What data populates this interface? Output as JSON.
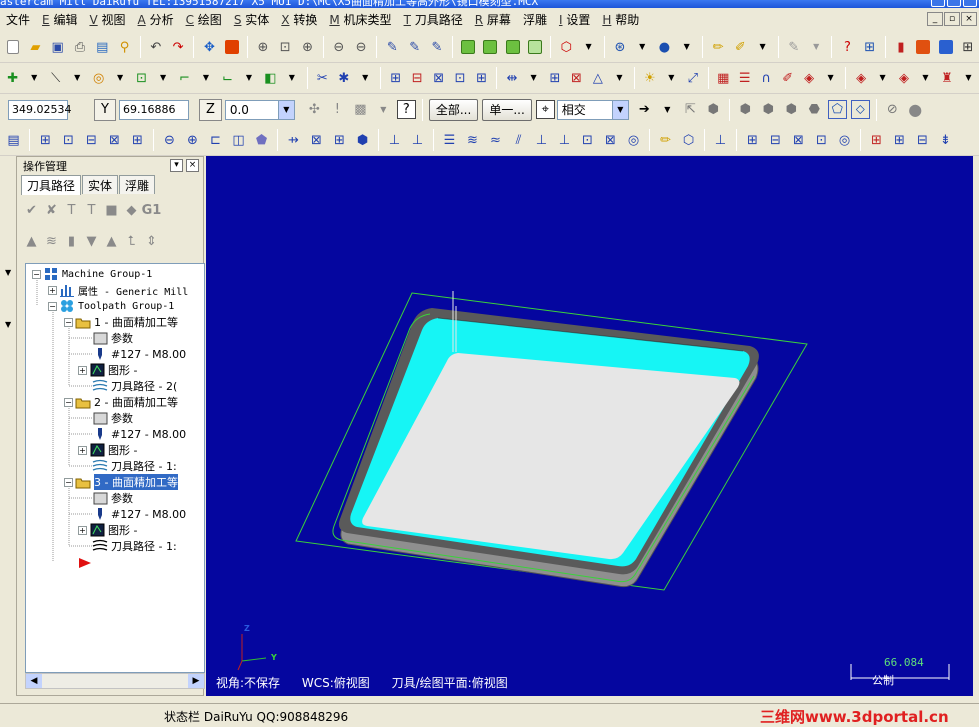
{
  "window": {
    "title": "astercam Mill DaiRuYu TEL:13951587217  X5 MU1  D:\\MC\\X5曲面精加工等高外形\\镜口模刻型.MCX"
  },
  "menu": [
    {
      "label": "文件",
      "accel": ""
    },
    {
      "label": "编辑",
      "accel": "E"
    },
    {
      "label": "视图",
      "accel": "V"
    },
    {
      "label": "分析",
      "accel": "A"
    },
    {
      "label": "绘图",
      "accel": "C"
    },
    {
      "label": "实体",
      "accel": "S"
    },
    {
      "label": "转换",
      "accel": "X"
    },
    {
      "label": "机床类型",
      "accel": "M"
    },
    {
      "label": "刀具路径",
      "accel": "T"
    },
    {
      "label": "屏幕",
      "accel": "R"
    },
    {
      "label": "浮雕",
      "accel": ""
    },
    {
      "label": "设置",
      "accel": "I"
    },
    {
      "label": "帮助",
      "accel": "H"
    }
  ],
  "autocursor": {
    "x_value": "349.02534",
    "y_label": "Y",
    "y_value": "69.16886",
    "z_label": "Z",
    "z_value": "0.0",
    "all_button": "全部...",
    "single_button": "单一...",
    "snap_mode": "相交"
  },
  "panel": {
    "title": "操作管理",
    "tabs": [
      "刀具路径",
      "实体",
      "浮雕"
    ],
    "active_tab": 0,
    "op_g1": "G1"
  },
  "tree": {
    "machine_group": "Machine Group-1",
    "properties": "属性 - Generic Mill",
    "toolpath_group": "Toolpath Group-1",
    "operations": [
      {
        "title": "1 - 曲面精加工等",
        "params": "参数",
        "tool": "#127 - M8.00",
        "geometry": "图形 -",
        "toolpath": "刀具路径 - 2("
      },
      {
        "title": "2 - 曲面精加工等",
        "params": "参数",
        "tool": "#127 - M8.00",
        "geometry": "图形 -",
        "toolpath": "刀具路径 - 1:"
      },
      {
        "title": "3 - 曲面精加工等",
        "params": "参数",
        "tool": "#127 - M8.00",
        "geometry": "图形 -",
        "toolpath": "刀具路径 - 1:"
      }
    ],
    "selected_operation": 2
  },
  "viewport": {
    "bg_color": "#05069f",
    "view": "视角:不保存",
    "wcs": "WCS:俯视图",
    "plane": "刀具/绘图平面:俯视图",
    "scale_value": "66.084",
    "scale_unit": "公制",
    "axis_z": "Z",
    "axis_y": "Y"
  },
  "statusbar": {
    "label": "状态栏",
    "text": "DaiRuYu QQ:908848296",
    "watermark": "三维网www.3dportal.cn"
  },
  "colors": {
    "model_cyan": "#16f5f5",
    "model_gray": "#e6e6e6",
    "boundary_green": "#3ad23a"
  }
}
